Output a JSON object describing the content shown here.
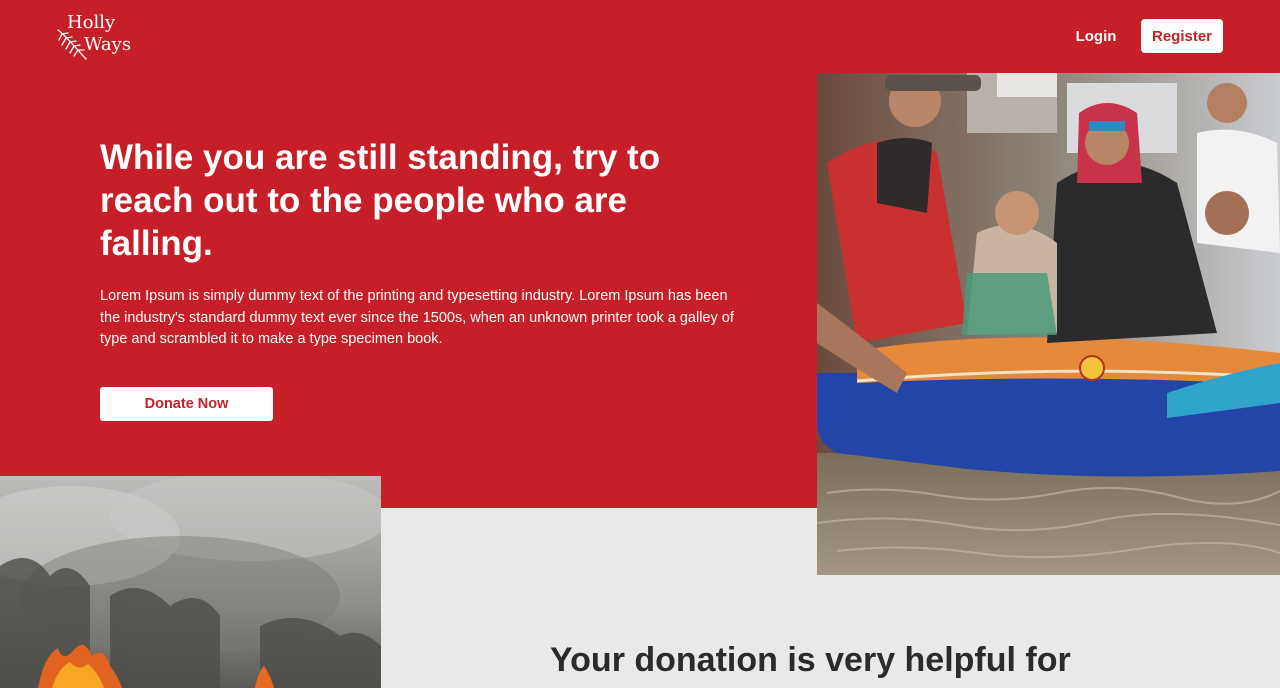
{
  "header": {
    "logo": {
      "line1": "Holly",
      "line2": "Ways"
    },
    "nav": {
      "login_label": "Login",
      "register_label": "Register"
    }
  },
  "hero": {
    "title": "While you are still standing, try to reach out to the people who are falling.",
    "description": "Lorem Ipsum is simply dummy text of the printing and typesetting industry. Lorem Ipsum has been the industry's standard dummy text ever since the 1500s, when an unknown printer took a galley of type and scrambled it to make a type specimen book.",
    "donate_label": "Donate Now"
  },
  "section": {
    "title": "Your donation is very helpful for"
  },
  "colors": {
    "brand_red": "#c71f27",
    "light_gray": "#e9e9e9",
    "white": "#ffffff"
  }
}
